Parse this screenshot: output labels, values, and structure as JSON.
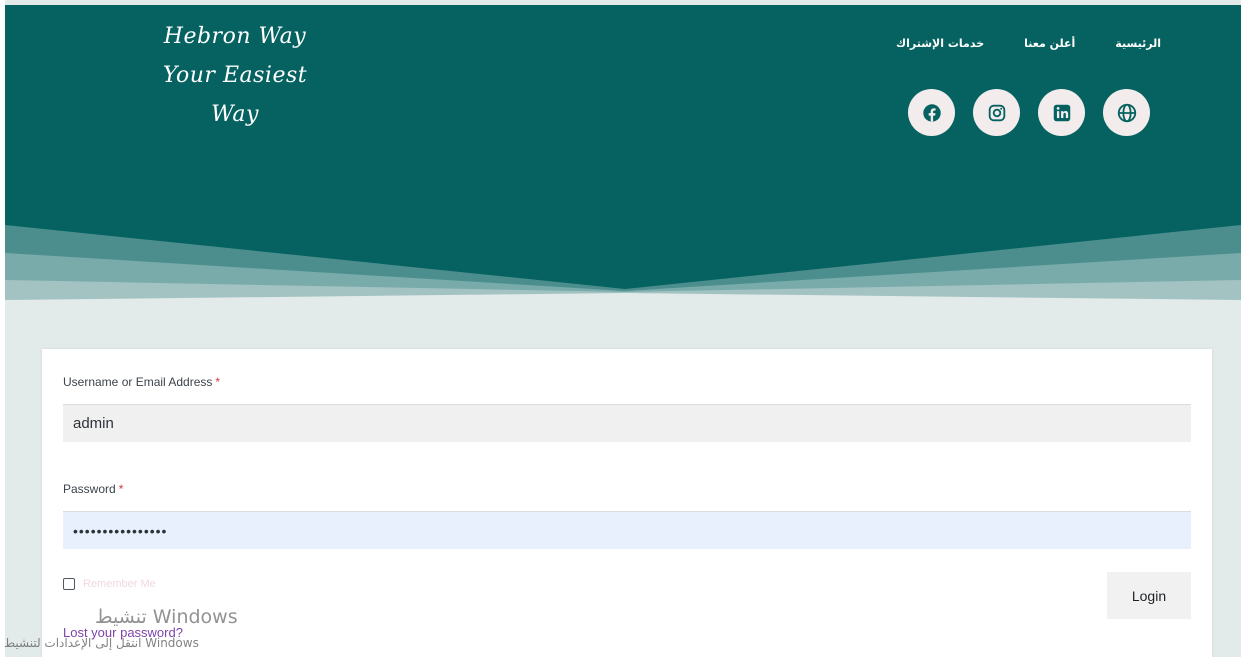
{
  "brand": {
    "logo_lines": [
      "Hebron Way",
      "Your Easiest",
      "Way"
    ]
  },
  "nav": {
    "items": [
      {
        "label": "الرئيسية"
      },
      {
        "label": "أعلن معنا"
      },
      {
        "label": "خدمات الإشتراك"
      }
    ]
  },
  "social": [
    {
      "icon": "globe-icon"
    },
    {
      "icon": "linkedin-icon"
    },
    {
      "icon": "instagram-icon"
    },
    {
      "icon": "facebook-icon"
    }
  ],
  "colors": {
    "header": "#066261",
    "page_background": "#e2eaea",
    "link": "#7e43a8",
    "required": "#d63638"
  },
  "login_form": {
    "username_label": "Username or Email Address",
    "username_value": "admin",
    "password_label": "Password",
    "password_value": "••••••••••••••••",
    "required_mark": "*",
    "remember_label": "Remember Me",
    "remember_checked": false,
    "login_button": "Login",
    "lost_password_link": "Lost your password?"
  },
  "windows_watermark": {
    "title": "تنشيط Windows",
    "subtitle": "انتقل إلى الإعدادات لتنشيط Windows"
  }
}
